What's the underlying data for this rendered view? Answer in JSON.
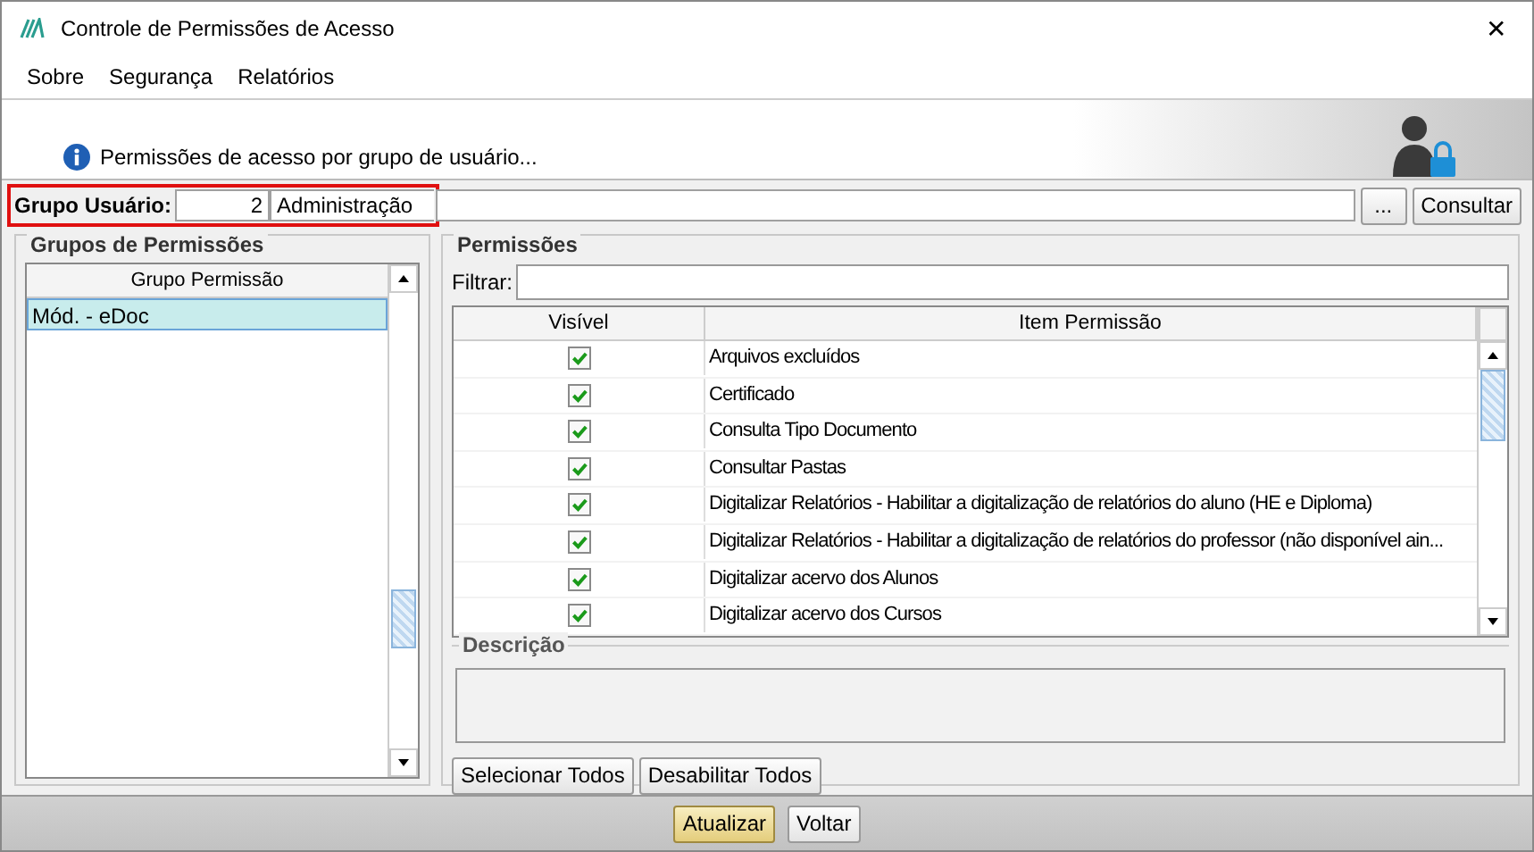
{
  "window": {
    "title": "Controle de Permissões de Acesso",
    "close": "✕"
  },
  "menu": [
    {
      "label": "Sobre"
    },
    {
      "label": "Segurança"
    },
    {
      "label": "Relatórios"
    }
  ],
  "header": {
    "message": "Permissões de acesso por grupo de usuário..."
  },
  "user_group": {
    "label": "Grupo Usuário:",
    "code": "2",
    "name": "Administração",
    "highlighted": true,
    "browse_button": "...",
    "search_button": "Consultar"
  },
  "groups": {
    "title": "Grupos de Permissões",
    "column": "Grupo Permissão",
    "rows": [
      {
        "label": "Mód. - eDoc",
        "selected": true
      }
    ]
  },
  "permissions": {
    "title": "Permissões",
    "filter_label": "Filtrar:",
    "columns": [
      "Visível",
      "Item Permissão"
    ],
    "rows": [
      {
        "visible": true,
        "item": "Arquivos excluídos"
      },
      {
        "visible": true,
        "item": "Certificado"
      },
      {
        "visible": true,
        "item": "Consulta Tipo Documento"
      },
      {
        "visible": true,
        "item": "Consultar Pastas"
      },
      {
        "visible": true,
        "item": "Digitalizar Relatórios - Habilitar a digitalização de relatórios do aluno (HE e Diploma)"
      },
      {
        "visible": true,
        "item": "Digitalizar Relatórios - Habilitar a digitalização de relatórios do professor (não disponível ain..."
      },
      {
        "visible": true,
        "item": "Digitalizar acervo dos Alunos"
      },
      {
        "visible": true,
        "item": "Digitalizar acervo dos Cursos"
      }
    ],
    "description_title": "Descrição",
    "buttons": [
      "Selecionar Todos",
      "Desabilitar Todos"
    ]
  },
  "footer": {
    "buttons": [
      {
        "label": "Atualizar",
        "default": true
      },
      {
        "label": "Voltar",
        "default": false
      }
    ]
  }
}
